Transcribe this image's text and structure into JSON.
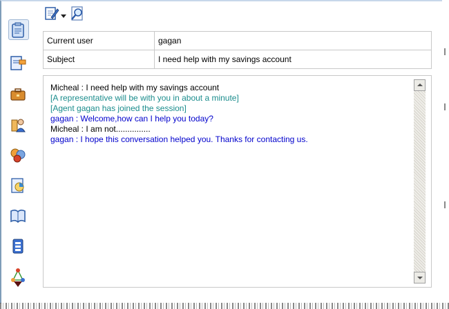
{
  "colors": {
    "customer_text": "#000000",
    "system_text": "#1a8c8c",
    "agent_text": "#0000cc",
    "border": "#c8c8c8"
  },
  "sidebar": {
    "items": [
      {
        "icon": "clipboard-icon",
        "active": true
      },
      {
        "icon": "edit-document-icon"
      },
      {
        "icon": "briefcase-icon"
      },
      {
        "icon": "users-icon"
      },
      {
        "icon": "group-icon"
      },
      {
        "icon": "report-chart-icon"
      },
      {
        "icon": "book-icon"
      },
      {
        "icon": "document-stack-icon"
      },
      {
        "icon": "network-icon"
      },
      {
        "icon": "more-down-arrow-icon"
      }
    ]
  },
  "toolbar": {
    "items": [
      {
        "icon": "edit-icon"
      },
      {
        "icon": "dropdown-arrow-icon"
      },
      {
        "icon": "search-document-icon"
      }
    ]
  },
  "info": {
    "current_user_label": "Current user",
    "current_user_value": "gagan",
    "subject_label": "Subject",
    "subject_value": "I need help with my savings account"
  },
  "transcript": {
    "messages": [
      {
        "text": "Micheal : I need help with my savings account",
        "kind": "customer"
      },
      {
        "text": "[A representative will be with you in about a minute]",
        "kind": "system"
      },
      {
        "text": "[Agent gagan has joined the session]",
        "kind": "system"
      },
      {
        "text": "gagan : Welcome,how can I help you today?",
        "kind": "agent"
      },
      {
        "text": "Micheal : I am not...............",
        "kind": "customer"
      },
      {
        "text": "gagan : I hope this conversation helped you. Thanks for contacting us.",
        "kind": "agent"
      }
    ]
  }
}
